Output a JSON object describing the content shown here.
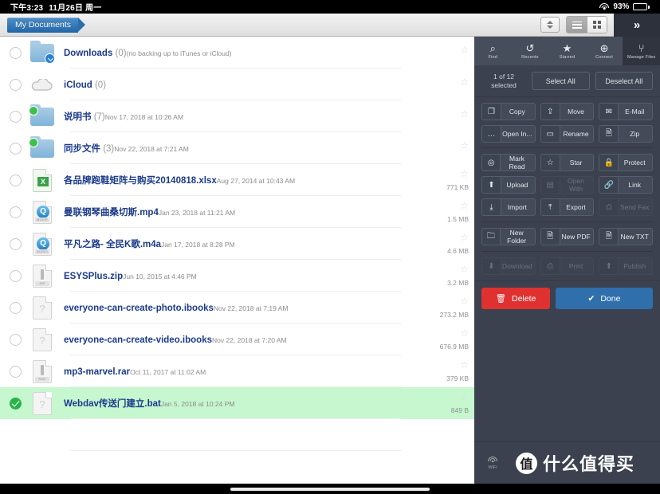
{
  "status_bar": {
    "time": "下午3:23",
    "date": "11月26日 周一",
    "wifi_icon": "wifi-icon",
    "battery_percent": "93%"
  },
  "topbar": {
    "breadcrumb": "My Documents",
    "sort_stepper_icon": "sort-stepper-icon",
    "list_view_icon": "list-view-icon",
    "grid_view_icon": "grid-view-icon",
    "expand_chevron": "»"
  },
  "files": [
    {
      "name": "Downloads",
      "count": "(0)",
      "sub": "(no backing up to iTunes or iCloud)",
      "size": "",
      "icon": "folder-download-icon",
      "selected": false,
      "star": "☆"
    },
    {
      "name": "iCloud",
      "count": "(0)",
      "sub": "",
      "size": "",
      "icon": "cloud-icon",
      "selected": false,
      "star": "☆"
    },
    {
      "name": "说明书",
      "count": "(7)",
      "sub": "Nov 17, 2018 at 10:26 AM",
      "size": "",
      "icon": "folder-sync-icon",
      "selected": false,
      "star": "☆"
    },
    {
      "name": "同步文件",
      "count": "(3)",
      "sub": "Nov 22, 2018 at 7:21 AM",
      "size": "",
      "icon": "folder-sync-icon",
      "selected": false,
      "star": "☆"
    },
    {
      "name": "各品牌跑鞋矩阵与购买20140818.xlsx",
      "count": "",
      "sub": "Aug 27, 2014 at 10:43 AM",
      "size": "771 KB",
      "icon": "spreadsheet-icon",
      "selected": false,
      "star": "☆"
    },
    {
      "name": "曼联钢琴曲桑切斯.mp4",
      "count": "",
      "sub": "Jan 23, 2018 at 11:21 AM",
      "size": "1.5 MB",
      "icon": "movie-icon",
      "selected": false,
      "star": "☆"
    },
    {
      "name": "平凡之路- 全民K歌.m4a",
      "count": "",
      "sub": "Jan 17, 2018 at 8:28 PM",
      "size": "4.6 MB",
      "icon": "audio-icon",
      "selected": false,
      "star": "☆"
    },
    {
      "name": "ESYSPlus.zip",
      "count": "",
      "sub": "Jun 10, 2015 at 4:46 PM",
      "size": "3.2 MB",
      "icon": "zip-icon",
      "selected": false,
      "star": "☆"
    },
    {
      "name": "everyone-can-create-photo.ibooks",
      "count": "",
      "sub": "Nov 22, 2018 at 7:19 AM",
      "size": "273.2 MB",
      "icon": "unknown-file-icon",
      "selected": false,
      "star": "☆"
    },
    {
      "name": "everyone-can-create-video.ibooks",
      "count": "",
      "sub": "Nov 22, 2018 at 7:20 AM",
      "size": "676.9 MB",
      "icon": "unknown-file-icon",
      "selected": false,
      "star": "☆"
    },
    {
      "name": "mp3-marvel.rar",
      "count": "",
      "sub": "Oct 11, 2017 at 11:02 AM",
      "size": "379 KB",
      "icon": "rar-icon",
      "selected": false,
      "star": "☆"
    },
    {
      "name": "Webdav传送门建立.bat",
      "count": "",
      "sub": "Jan 5, 2018 at 10:24 PM",
      "size": "849 B",
      "icon": "unknown-file-icon",
      "selected": true,
      "star": "☆"
    }
  ],
  "panel": {
    "tabs": [
      {
        "label": "Find",
        "glyph": "⌕",
        "icon": "search-icon",
        "active": false
      },
      {
        "label": "Recents",
        "glyph": "↺",
        "icon": "history-icon",
        "active": false
      },
      {
        "label": "Starred",
        "glyph": "★",
        "icon": "star-icon",
        "active": false
      },
      {
        "label": "Connect",
        "glyph": "⊕",
        "icon": "globe-icon",
        "active": false
      },
      {
        "label": "Manage Files",
        "glyph": "⑂",
        "icon": "tools-icon",
        "active": true
      }
    ],
    "selection": {
      "count_text": "1 of 12 selected",
      "select_all": "Select All",
      "deselect_all": "Deselect All"
    },
    "action_groups": [
      {
        "rows": [
          [
            {
              "label": "Copy",
              "icon": "copy-icon",
              "glyph": "❐",
              "enabled": true
            },
            {
              "label": "Move",
              "icon": "move-icon",
              "glyph": "⇪",
              "enabled": true
            },
            {
              "label": "E-Mail",
              "icon": "mail-icon",
              "glyph": "✉",
              "enabled": true
            }
          ],
          [
            {
              "label": "Open In...",
              "icon": "open-in-icon",
              "glyph": "…",
              "enabled": true
            },
            {
              "label": "Rename",
              "icon": "rename-icon",
              "glyph": "▭",
              "enabled": true
            },
            {
              "label": "Zip",
              "icon": "zip-icon",
              "glyph": "🗎",
              "enabled": true
            }
          ]
        ]
      },
      {
        "rows": [
          [
            {
              "label": "Mark Read",
              "icon": "mark-read-icon",
              "glyph": "◎",
              "enabled": true
            },
            {
              "label": "Star",
              "icon": "star-icon",
              "glyph": "☆",
              "enabled": true
            },
            {
              "label": "Protect",
              "icon": "lock-icon",
              "glyph": "🔒",
              "enabled": true
            }
          ],
          [
            {
              "label": "Upload",
              "icon": "upload-icon",
              "glyph": "⬆",
              "enabled": true
            },
            {
              "label": "Open With",
              "icon": "open-with-icon",
              "glyph": "▤",
              "enabled": false
            },
            {
              "label": "Link",
              "icon": "link-icon",
              "glyph": "🔗",
              "enabled": true
            }
          ],
          [
            {
              "label": "Import",
              "icon": "import-icon",
              "glyph": "⤓",
              "enabled": true
            },
            {
              "label": "Export",
              "icon": "export-icon",
              "glyph": "⤒",
              "enabled": true
            },
            {
              "label": "Send Fax",
              "icon": "fax-icon",
              "glyph": "⎙",
              "enabled": false
            }
          ]
        ]
      },
      {
        "rows": [
          [
            {
              "label": "New Folder",
              "icon": "new-folder-icon",
              "glyph": "🗀",
              "enabled": true
            },
            {
              "label": "New PDF",
              "icon": "new-pdf-icon",
              "glyph": "🗎",
              "enabled": true
            },
            {
              "label": "New TXT",
              "icon": "new-txt-icon",
              "glyph": "🗎",
              "enabled": true
            }
          ]
        ]
      },
      {
        "rows": [
          [
            {
              "label": "Download",
              "icon": "download-icon",
              "glyph": "⬇",
              "enabled": false
            },
            {
              "label": "Print",
              "icon": "print-icon",
              "glyph": "⎙",
              "enabled": false
            },
            {
              "label": "Publish",
              "icon": "publish-icon",
              "glyph": "⬆",
              "enabled": false
            }
          ]
        ]
      }
    ],
    "footer_buttons": {
      "delete": "Delete",
      "delete_icon": "trash-icon",
      "delete_color": "#e03131",
      "done": "Done",
      "done_icon": "check-icon",
      "done_color": "#2f6fab"
    },
    "bottom": {
      "wifi_label": "WiFi",
      "wifi_icon": "wifi-icon",
      "watermark_logo": "值",
      "watermark_text": "什么值得买"
    }
  }
}
